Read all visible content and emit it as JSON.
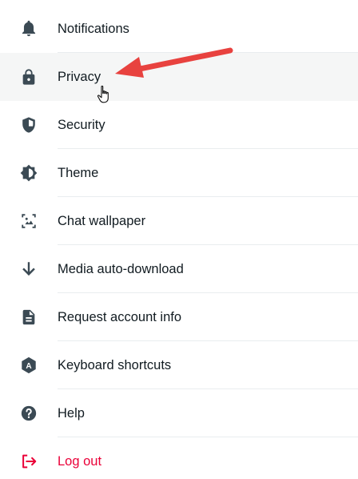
{
  "menu": {
    "items": [
      {
        "label": "Notifications",
        "icon": "bell-icon"
      },
      {
        "label": "Privacy",
        "icon": "lock-icon",
        "active": true
      },
      {
        "label": "Security",
        "icon": "shield-icon"
      },
      {
        "label": "Theme",
        "icon": "theme-icon"
      },
      {
        "label": "Chat wallpaper",
        "icon": "wallpaper-icon"
      },
      {
        "label": "Media auto-download",
        "icon": "download-arrow-icon"
      },
      {
        "label": "Request account info",
        "icon": "document-icon"
      },
      {
        "label": "Keyboard shortcuts",
        "icon": "keyboard-shortcuts-icon"
      },
      {
        "label": "Help",
        "icon": "help-icon"
      },
      {
        "label": "Log out",
        "icon": "logout-icon",
        "danger": true
      }
    ]
  },
  "colors": {
    "text": "#111b21",
    "icon": "#3b4a54",
    "danger": "#ea0038",
    "active_bg": "#f5f6f6",
    "divider": "#e9edef",
    "annotation_arrow": "#e8423f"
  }
}
